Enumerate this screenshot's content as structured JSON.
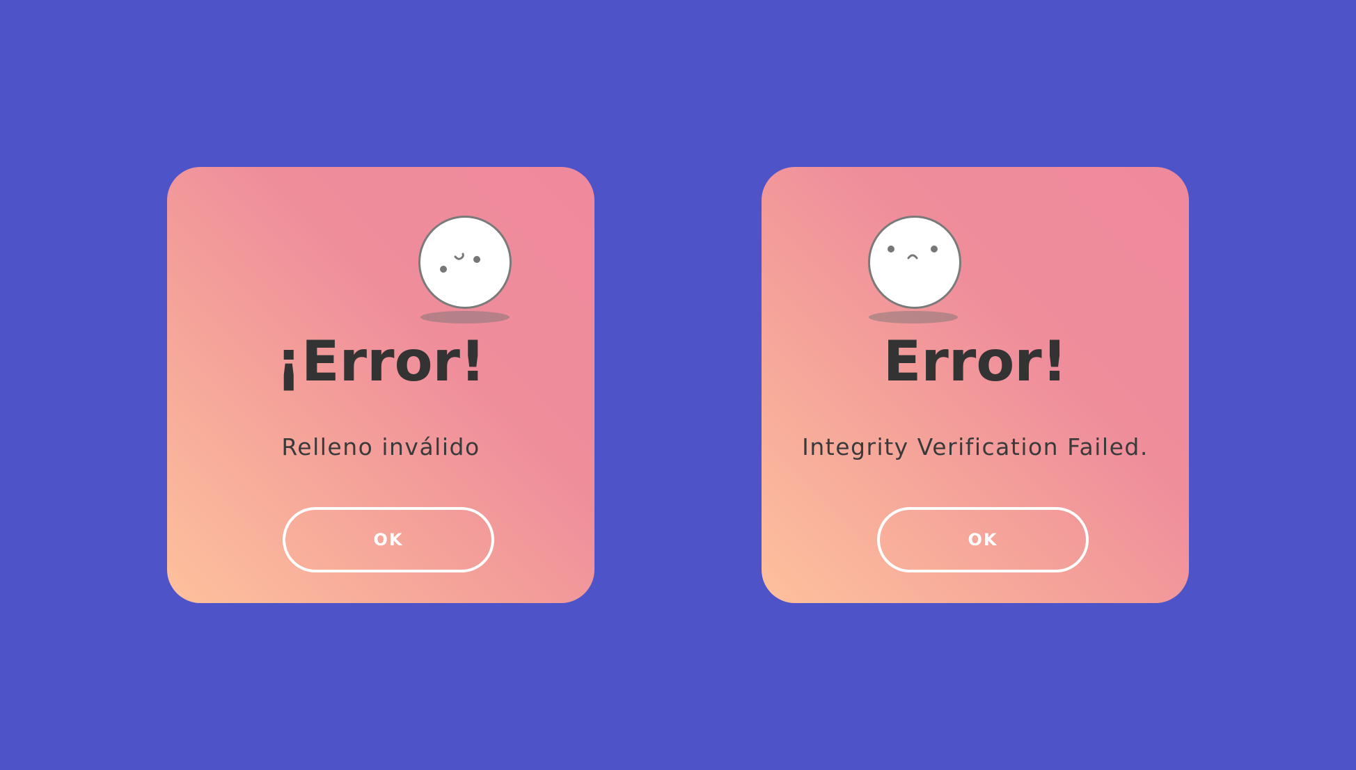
{
  "colors": {
    "background": "#4e54c8",
    "card_gradient_top": "#ef8a9d",
    "card_gradient_bottom": "#fec19d",
    "text": "#333333",
    "button_border": "#ffffff"
  },
  "dialogs": [
    {
      "face_icon": "winking-face-icon",
      "title": "¡Error!",
      "message": "Relleno inválido",
      "button_label": "OK"
    },
    {
      "face_icon": "sad-face-icon",
      "title": "Error!",
      "message": "Integrity Verification Failed.",
      "button_label": "OK"
    }
  ]
}
